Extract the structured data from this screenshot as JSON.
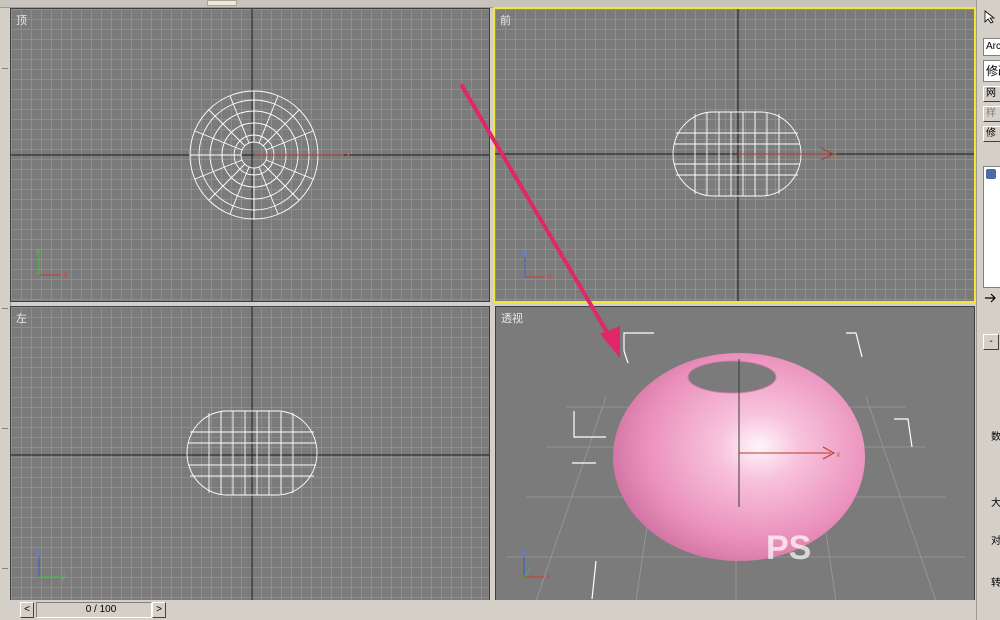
{
  "viewports": {
    "top": {
      "label": "顶"
    },
    "front": {
      "label": "前"
    },
    "left": {
      "label": "左"
    },
    "perspective": {
      "label": "透视"
    }
  },
  "axes": {
    "x": "x",
    "y": "y",
    "z": "z"
  },
  "timeline": {
    "position": "0 / 100",
    "prev_icon": "<",
    "next_icon": ">"
  },
  "command_panel": {
    "object_name": "Arc",
    "modifier_dropdown": "修改",
    "btn_1": "网",
    "btn_2": "样",
    "btn_3": "修",
    "minus_btn": "-",
    "side_labels": [
      "数",
      "大",
      "对",
      "转"
    ]
  },
  "colors": {
    "viewport_bg": "#7b7b7b",
    "active_border": "#f0e63c",
    "annotation_arrow": "#e0276a",
    "sphere": "#f2a8c8",
    "wireframe": "#ffffff"
  },
  "watermark": {
    "text": "PS"
  }
}
